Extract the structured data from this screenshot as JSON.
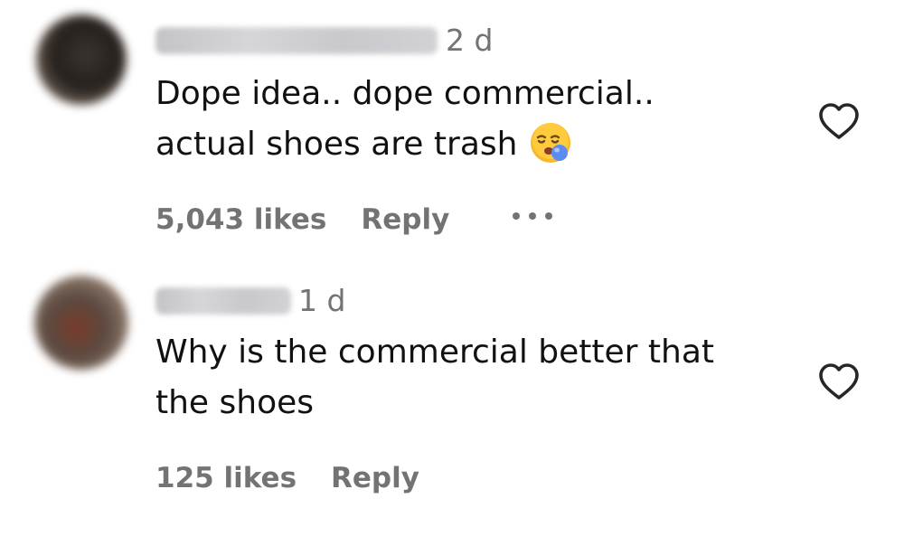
{
  "comments": [
    {
      "time": "2 d",
      "line1": "Dope idea.. dope commercial..",
      "line2": "actual shoes are trash",
      "emoji_icon": "sleepy-face-emoji-icon",
      "likes": "5,043 likes",
      "reply_label": "Reply",
      "has_more_menu": true
    },
    {
      "time": "1 d",
      "line1": "Why is the commercial better that",
      "line2": "the shoes",
      "likes": "125 likes",
      "reply_label": "Reply",
      "has_more_menu": false
    }
  ],
  "colors": {
    "text": "#111111",
    "secondary": "#737373",
    "heart_outline": "#262626",
    "background": "#ffffff"
  }
}
